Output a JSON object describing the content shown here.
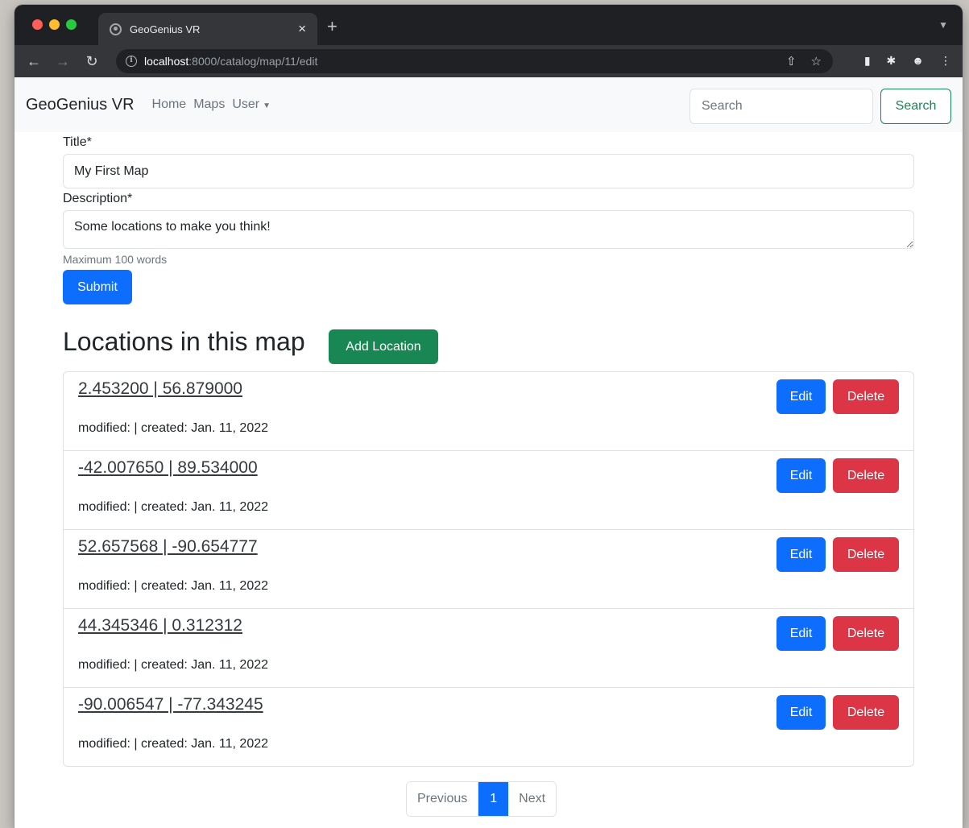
{
  "browser": {
    "tab_title": "GeoGenius VR",
    "tab_close": "×",
    "new_tab": "+",
    "url_host": "localhost",
    "url_rest": ":8000/catalog/map/11/edit"
  },
  "navbar": {
    "brand": "GeoGenius VR",
    "links": [
      "Home",
      "Maps",
      "User"
    ],
    "search_placeholder": "Search",
    "search_button": "Search"
  },
  "form": {
    "title_label": "Title*",
    "title_value": "My First Map",
    "description_label": "Description*",
    "description_value": "Some locations to make you think!",
    "help_text": "Maximum 100 words",
    "submit_label": "Submit"
  },
  "locations": {
    "heading": "Locations in this map",
    "add_button": "Add Location",
    "edit_label": "Edit",
    "delete_label": "Delete",
    "items": [
      {
        "coords": "2.453200 | 56.879000",
        "meta": "modified: | created: Jan. 11, 2022"
      },
      {
        "coords": "-42.007650 | 89.534000",
        "meta": "modified: | created: Jan. 11, 2022"
      },
      {
        "coords": "52.657568 | -90.654777",
        "meta": "modified: | created: Jan. 11, 2022"
      },
      {
        "coords": "44.345346 | 0.312312",
        "meta": "modified: | created: Jan. 11, 2022"
      },
      {
        "coords": "-90.006547 | -77.343245",
        "meta": "modified: | created: Jan. 11, 2022"
      }
    ]
  },
  "pagination": {
    "previous": "Previous",
    "current": "1",
    "next": "Next"
  },
  "colors": {
    "primary": "#0d6efd",
    "success": "#198754",
    "danger": "#dc3545"
  }
}
